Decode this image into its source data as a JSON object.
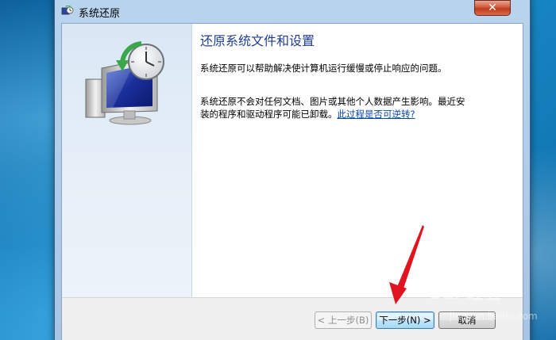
{
  "window": {
    "title": "系统还原",
    "close_label": "✕"
  },
  "content": {
    "heading": "还原系统文件和设置",
    "paragraph1": "系统还原可以帮助解决使计算机运行缓慢或停止响应的问题。",
    "paragraph2": "系统还原不会对任何文档、图片或其他个人数据产生影响。最近安装的程序和驱动程序可能已卸载。",
    "link_text": "此过程是否可逆转?"
  },
  "buttons": {
    "back": "< 上一步(B)",
    "next": "下一步(N) >",
    "cancel": "取消"
  },
  "watermark": {
    "text": "Bai 经验",
    "sub": "jingyan.baidu.com"
  },
  "icons": {
    "title_icon": "system-restore-icon",
    "main_icon": "system-restore-computer-icon",
    "annotation": "red-arrow-annotation"
  },
  "colors": {
    "heading": "#1e3d8c",
    "link": "#0645ad",
    "arrow": "#e0141e",
    "close_button": "#c13a1d"
  }
}
